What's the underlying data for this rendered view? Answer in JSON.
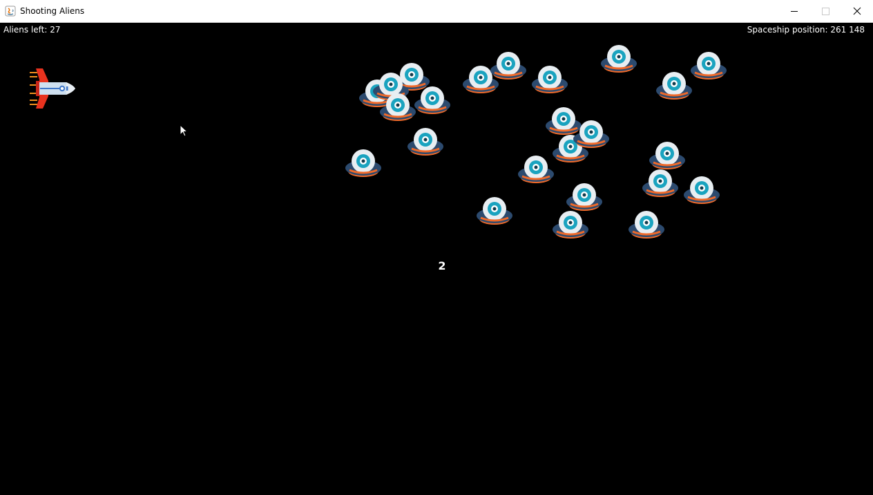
{
  "window": {
    "title": "Shooting Aliens",
    "controls": [
      "minimize-icon",
      "maximize-icon",
      "close-icon"
    ]
  },
  "hud": {
    "aliens_left": "Aliens left: 27",
    "spaceship_position": "Spaceship position: 261 148"
  },
  "countdown": "2",
  "colors": {
    "background": "#000000",
    "alien_body": "#2c4a6e",
    "alien_rim": "#f06a2a",
    "alien_dome": "#e8eef2",
    "alien_eye": "#1aa3bf",
    "ship_flame": "#e8321e",
    "ship_body": "#cfe0f0"
  },
  "sprites": {
    "spaceship": "spaceship-icon",
    "alien": "alien-ufo-icon",
    "alien_count_visible": 24
  }
}
